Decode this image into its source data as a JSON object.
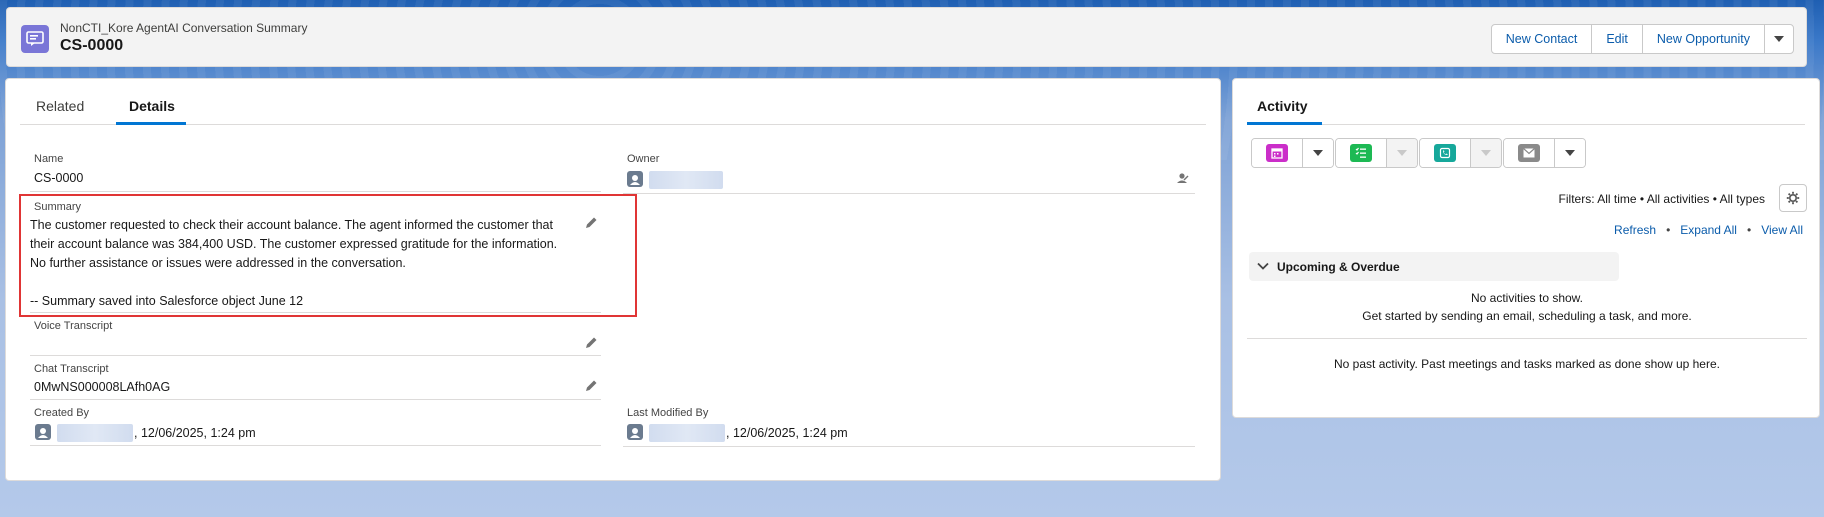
{
  "header": {
    "object_label": "NonCTI_Kore AgentAI Conversation Summary",
    "record_name": "CS-0000",
    "buttons": {
      "new_contact": "New Contact",
      "edit": "Edit",
      "new_opportunity": "New Opportunity"
    }
  },
  "tabs": {
    "related": "Related",
    "details": "Details"
  },
  "fields": {
    "name_label": "Name",
    "name_value": "CS-0000",
    "owner_label": "Owner",
    "summary_label": "Summary",
    "summary_lines": [
      "The customer requested to check their account balance. The agent informed the customer that",
      "their account balance was 384,400 USD. The customer expressed gratitude for the information.",
      "No further assistance or issues were addressed in the conversation.",
      "",
      "-- Summary saved into Salesforce object June 12"
    ],
    "voice_label": "Voice Transcript",
    "chat_label": "Chat Transcript",
    "chat_value": "0MwNS000008LAfh0AG",
    "created_label": "Created By",
    "created_value": ", 12/06/2025, 1:24 pm",
    "modified_label": "Last Modified By",
    "modified_value": ", 12/06/2025, 1:24 pm"
  },
  "activity": {
    "title": "Activity",
    "filters": "Filters: All time • All activities • All types",
    "links": {
      "refresh": "Refresh",
      "sep": "•",
      "expand_all": "Expand All",
      "view_all": "View All"
    },
    "upcoming_label": "Upcoming & Overdue",
    "no_activities": "No activities to show.",
    "get_started": "Get started by sending an email, scheduling a task, and more.",
    "no_past": "No past activity. Past meetings and tasks marked as done show up here."
  },
  "colors": {
    "event_icon": "#cb2ec9",
    "task_icon": "#1db954",
    "call_icon": "#16a89b",
    "email_icon": "#8a8a8a",
    "header_icon": "#7a76d7",
    "highlight_border": "#e03535"
  }
}
